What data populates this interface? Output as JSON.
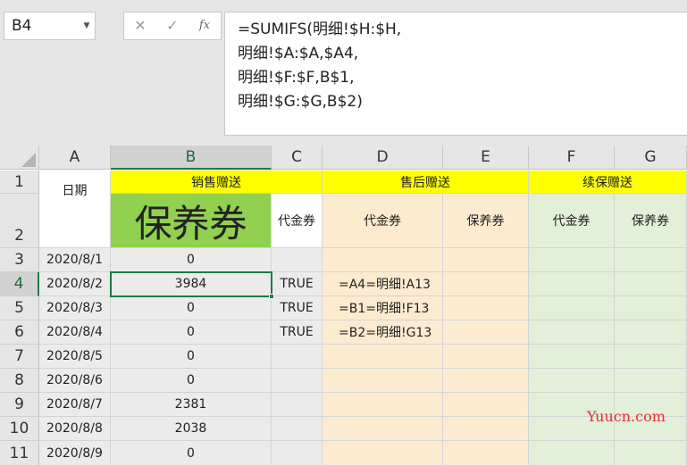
{
  "name_box": "B4",
  "formula_bar": {
    "fx_label": "fx",
    "lines": [
      "=SUMIFS(明细!$H:$H,",
      "明细!$A:$A,$A4,",
      "明细!$F:$F,B$1,",
      "明细!$G:$G,B$2)"
    ]
  },
  "columns": [
    "A",
    "B",
    "C",
    "D",
    "E",
    "F",
    "G"
  ],
  "rows": [
    "1",
    "2",
    "3",
    "4",
    "5",
    "6",
    "7",
    "8",
    "9",
    "10",
    "11"
  ],
  "header_row1": {
    "sales_gift": "销售赠送",
    "after_sales_gift": "售后赠送",
    "renewal_gift": "续保赠送"
  },
  "header_row2": {
    "date": "日期",
    "b": "保养券",
    "c": "代金券",
    "d": "代金券",
    "e": "保养券",
    "f": "代金券",
    "g": "保养券"
  },
  "dates": [
    "2020/8/1",
    "2020/8/2",
    "2020/8/3",
    "2020/8/4",
    "2020/8/5",
    "2020/8/6",
    "2020/8/7",
    "2020/8/8",
    "2020/8/9"
  ],
  "values_b": [
    "0",
    "3984",
    "0",
    "0",
    "0",
    "0",
    "2381",
    "2038",
    "0"
  ],
  "values_c": [
    "",
    "TRUE",
    "TRUE",
    "TRUE",
    "",
    "",
    "",
    "",
    ""
  ],
  "values_d": [
    "",
    "=A4=明细!A13",
    "=B1=明细!F13",
    "=B2=明细!G13",
    "",
    "",
    "",
    "",
    ""
  ],
  "watermark": "Yuucn.com",
  "colors": {
    "yellow": "#ffff00",
    "green": "#92d050",
    "peach": "#fdebd0",
    "mint": "#e2efd9",
    "selection": "#1f7a42"
  }
}
